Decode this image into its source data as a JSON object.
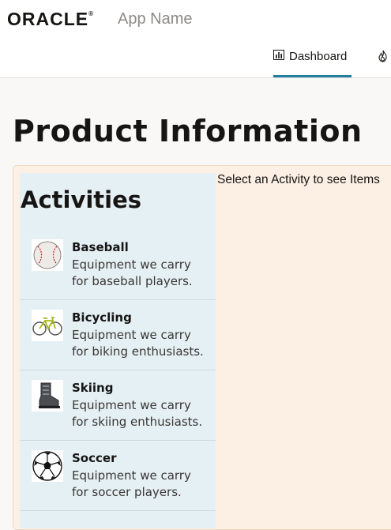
{
  "header": {
    "logo_text": "ORACLE",
    "logo_mark": "®",
    "app_name": "App Name",
    "tabs": [
      {
        "label": "Dashboard",
        "icon": "bar-chart-icon",
        "selected": true
      },
      {
        "label": "",
        "icon": "fire-icon",
        "selected": false
      }
    ]
  },
  "main": {
    "title": "Product Information",
    "activities_title": "Activities",
    "hint": "Select an Activity to see Items",
    "activities": [
      {
        "name": "Baseball",
        "description": "Equipment we carry for baseball players.",
        "icon": "baseball-icon"
      },
      {
        "name": "Bicycling",
        "description": "Equipment we carry for biking enthusiasts.",
        "icon": "bicycle-icon"
      },
      {
        "name": "Skiing",
        "description": "Equipment we carry for skiing enthusiasts.",
        "icon": "ski-boot-icon"
      },
      {
        "name": "Soccer",
        "description": "Equipment we carry for soccer players.",
        "icon": "soccer-ball-icon"
      }
    ]
  },
  "colors": {
    "accent": "#227e9e",
    "panel_background": "#fcf0e5",
    "list_background": "#e5f0f5"
  }
}
